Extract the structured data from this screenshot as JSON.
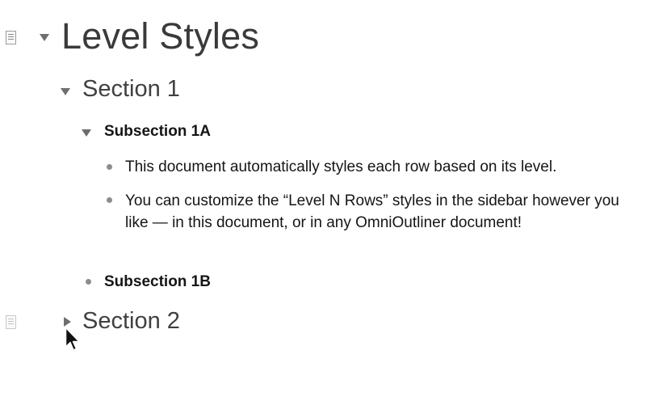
{
  "outline": {
    "title": "Level Styles",
    "section1": {
      "label": "Section 1",
      "subsection1a": {
        "label": "Subsection 1A",
        "row1": "This document automatically styles each row based on its level.",
        "row2": "You can customize the “Level N Rows” styles in the sidebar however you like — in this document, or in any OmniOutliner document!"
      },
      "subsection1b": {
        "label": "Subsection 1B"
      }
    },
    "section2": {
      "label": "Section 2",
      "collapsed": true
    }
  },
  "icons": {
    "note": "note-icon",
    "expanded": "disclosure-triangle-down-icon",
    "collapsed": "disclosure-triangle-right-icon",
    "bullet": "bullet-icon",
    "pointer": "mouse-pointer-icon"
  }
}
